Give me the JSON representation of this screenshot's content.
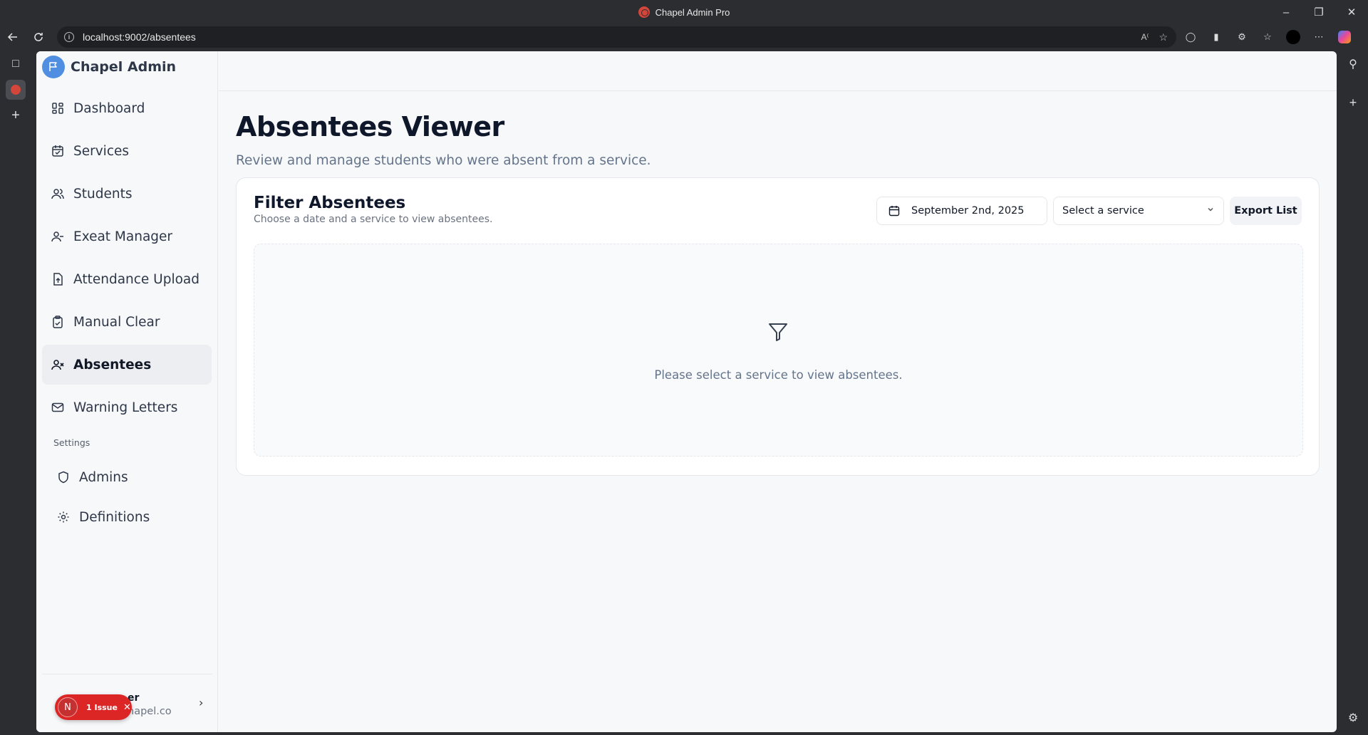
{
  "browser": {
    "window_title": "Chapel Admin Pro",
    "url": "localhost:9002/absentees"
  },
  "app": {
    "brand": "Chapel Admin"
  },
  "sidebar": {
    "items": [
      {
        "label": "Dashboard",
        "icon": "dashboard-icon"
      },
      {
        "label": "Services",
        "icon": "calendar-icon"
      },
      {
        "label": "Students",
        "icon": "users-icon"
      },
      {
        "label": "Exeat Manager",
        "icon": "user-minus-icon"
      },
      {
        "label": "Attendance Upload",
        "icon": "file-upload-icon"
      },
      {
        "label": "Manual Clear",
        "icon": "clipboard-check-icon"
      },
      {
        "label": "Absentees",
        "icon": "user-x-icon",
        "active": true
      },
      {
        "label": "Warning Letters",
        "icon": "mail-icon"
      }
    ],
    "settings_heading": "Settings",
    "settings_items": [
      {
        "label": "Admins",
        "icon": "shield-icon"
      },
      {
        "label": "Definitions",
        "icon": "gear-icon"
      }
    ],
    "footer": {
      "user_name_partial": "er",
      "user_email_partial": "hapel.co",
      "issue_avatar": "N",
      "issue_label": "1 Issue"
    }
  },
  "page": {
    "title": "Absentees Viewer",
    "subtitle": "Review and manage students who were absent from a service."
  },
  "filter_card": {
    "title": "Filter Absentees",
    "description": "Choose a date and a service to view absentees.",
    "date_value": "September 2nd, 2025",
    "service_placeholder": "Select a service",
    "export_label": "Export List",
    "empty_message": "Please select a service to view absentees."
  },
  "colors": {
    "brand_blue": "#4f8ee0",
    "issue_red": "#dc2626",
    "active_bg": "#edeef1"
  }
}
